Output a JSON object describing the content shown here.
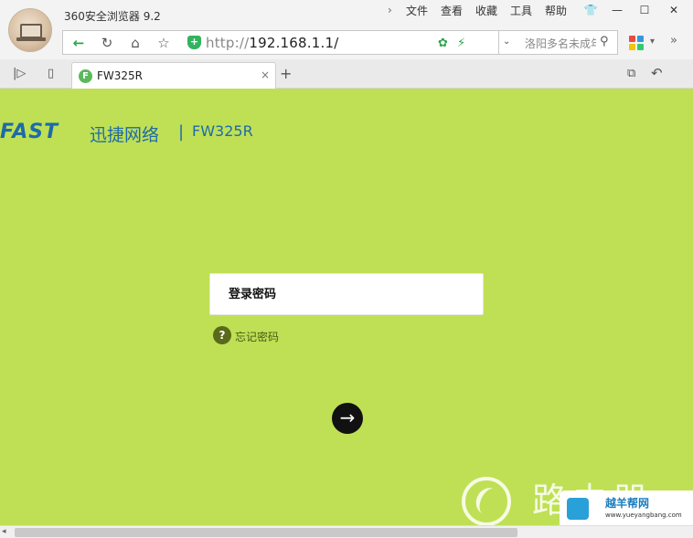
{
  "browser": {
    "app_title": "360安全浏览器 9.2",
    "menu": [
      "文件",
      "查看",
      "收藏",
      "工具",
      "帮助"
    ],
    "menu_more": "›",
    "window_controls": {
      "skin": "👕",
      "minimize": "—",
      "maximize": "☐",
      "close": "✕"
    }
  },
  "toolbar": {
    "back": "←",
    "refresh": "↻",
    "home": "⌂",
    "favorite": "☆",
    "secure_badge": "+",
    "url_protocol": "http://",
    "url_host": "192.168.1.1/",
    "speed_icons": [
      "✿",
      "⚡"
    ],
    "dropdown": "⌄",
    "search_placeholder": "洛阳多名未成年",
    "search_icon": "⚲",
    "apps_caret": "▾",
    "more": "»"
  },
  "tabs": {
    "side_left": "|▷",
    "side_phone": "▯",
    "items": [
      {
        "title": "FW325R",
        "favicon": "F",
        "close": "×"
      }
    ],
    "new_tab": "+",
    "restore": "⧉",
    "undo": "↶"
  },
  "page": {
    "logo": "FAST",
    "brand_cn": "迅捷网络",
    "separator": "|",
    "model": "FW325R",
    "password_placeholder": "登录密码",
    "forgot_icon": "?",
    "forgot_label": "忘记密码",
    "submit": "→"
  },
  "watermark": {
    "text": "路由器",
    "badge_cn": "越羊帮网",
    "badge_url": "www.yueyangbang.com"
  },
  "scrollbar": {
    "left_arrow": "◂"
  },
  "colors": {
    "page_bg": "#bfe054",
    "brand_blue": "#1e6aa8",
    "accent_green": "#2aa54a"
  }
}
